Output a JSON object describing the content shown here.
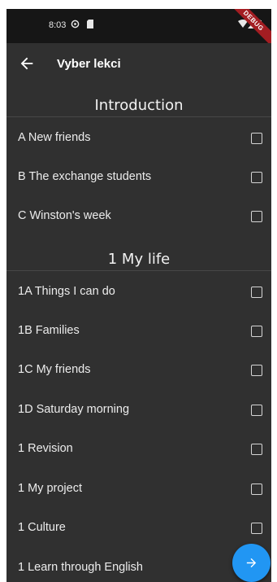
{
  "status_bar": {
    "time": "8:03",
    "debug_label": "DEBUG"
  },
  "app_bar": {
    "title": "Vyber lekci"
  },
  "sections": [
    {
      "title": "Introduction",
      "items": [
        {
          "label": "A New friends",
          "checked": false
        },
        {
          "label": "B The exchange students",
          "checked": false
        },
        {
          "label": "C Winston's week",
          "checked": false
        }
      ]
    },
    {
      "title": "1 My life",
      "items": [
        {
          "label": "1A Things I can do",
          "checked": false
        },
        {
          "label": "1B Families",
          "checked": false
        },
        {
          "label": "1C My friends",
          "checked": false
        },
        {
          "label": "1D Saturday morning",
          "checked": false
        },
        {
          "label": "1 Revision",
          "checked": false
        },
        {
          "label": "1 My project",
          "checked": false
        },
        {
          "label": "1 Culture",
          "checked": false
        },
        {
          "label": "1 Learn through English",
          "checked": false
        }
      ]
    }
  ],
  "colors": {
    "background": "#303030",
    "status_bar": "#161616",
    "accent": "#2196f3",
    "debug_banner": "#a31d22"
  }
}
